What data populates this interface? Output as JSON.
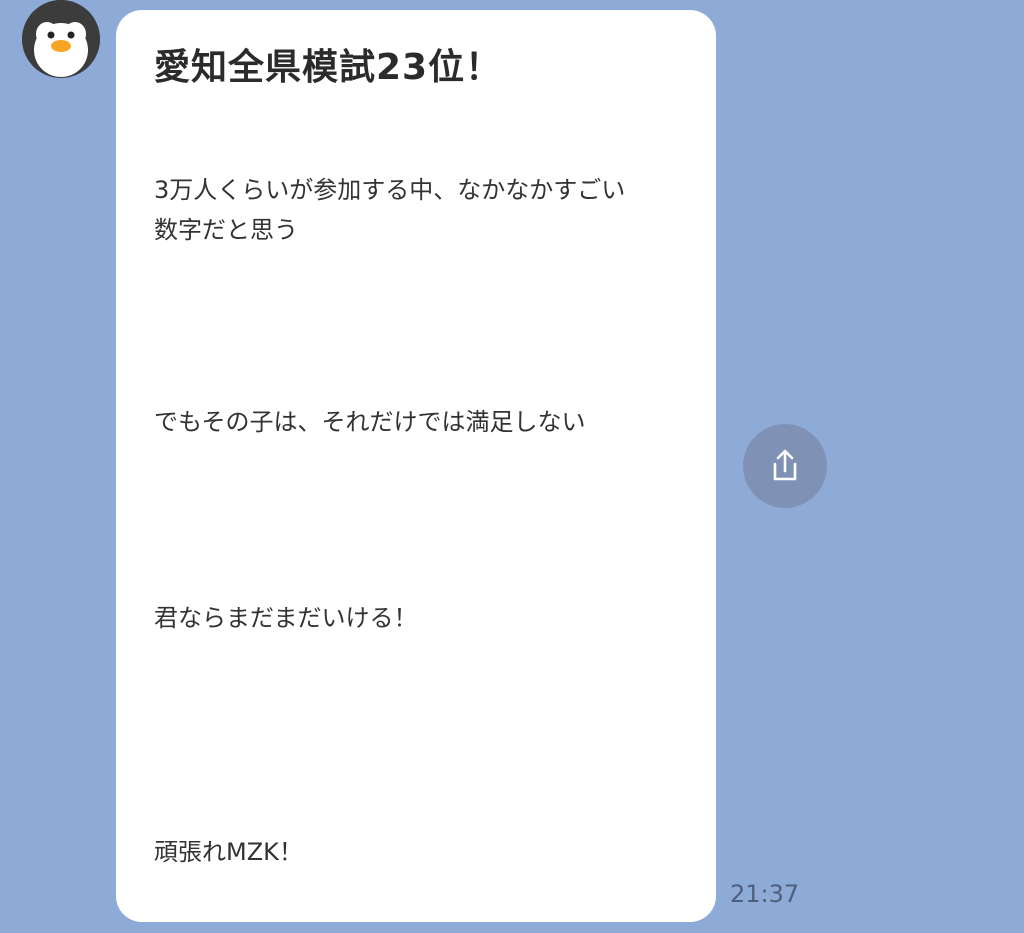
{
  "sender": {
    "avatar_icon": "penguin-avatar-icon"
  },
  "message": {
    "title": "愛知全県模試23位！",
    "paragraphs": [
      "3万人くらいが参加する中、なかなかすごい",
      "数字だと思う",
      "でもその子は、それだけでは満足しない",
      "君ならまだまだいける！",
      "頑張れMZK！"
    ],
    "time": "21:37"
  },
  "actions": {
    "share_icon": "share-icon"
  },
  "colors": {
    "background": "#8eabd8",
    "bubble": "#ffffff",
    "share_button": "#7f92b6"
  }
}
